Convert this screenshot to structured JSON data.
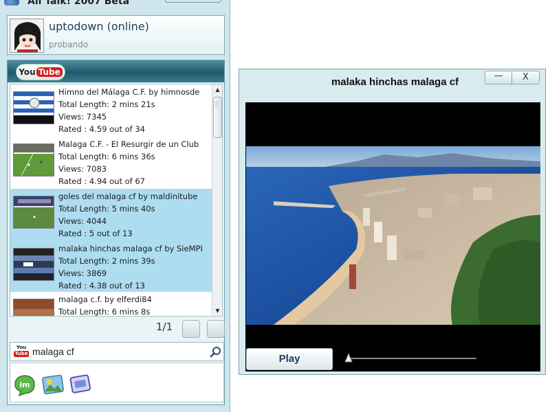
{
  "app": {
    "title": "All Talk! 2007 Beta"
  },
  "profile": {
    "name": "uptodown (online)",
    "status": "probando"
  },
  "youtube": {
    "logo_you": "You",
    "logo_tube": "Tube",
    "results": [
      {
        "title": "Himno del Málaga C.F. by himnosde",
        "length": "Total Length: 2 mins 21s",
        "views": "Views: 7345",
        "rated": "Rated : 4.59 out of 34",
        "selected": false,
        "thumb": "flag-stripes"
      },
      {
        "title": "Malaga C.F. - El Resurgir de un Club",
        "length": "Total Length: 6 mins 36s",
        "views": "Views: 7083",
        "rated": "Rated : 4.94 out of 67",
        "selected": false,
        "thumb": "football-pitch"
      },
      {
        "title": "goles del malaga cf by maldinitube",
        "length": "Total Length: 5 mins 40s",
        "views": "Views: 4044",
        "rated": "Rated : 5 out of 13",
        "selected": true,
        "thumb": "football-pitch"
      },
      {
        "title": "malaka hinchas malaga cf by SieMPI",
        "length": "Total Length: 2 mins 39s",
        "views": "Views: 3869",
        "rated": "Rated : 4.38 out of 13",
        "selected": true,
        "thumb": "stadium-crowd"
      },
      {
        "title": "malaga c.f. by elferdi84",
        "length": "Total Length: 6 mins 8s",
        "views": "",
        "rated": "",
        "selected": false,
        "thumb": "stadium-crowd"
      }
    ],
    "page_indicator": "1/1",
    "search_icon_you": "You",
    "search_icon_tube": "Tube",
    "search_value": "malaga cf"
  },
  "tray": {
    "icons": [
      "messenger-im-icon",
      "photo-gallery-icon",
      "video-screen-icon"
    ]
  },
  "player": {
    "title": "malaka hinchas malaga cf",
    "minimize_label": "—",
    "close_label": "X",
    "play_label": "Play",
    "progress_fraction": 0.0
  },
  "colors": {
    "window_bg": "#cfe6ec",
    "selected_row": "#aedcf0",
    "header_teal": "#1d5a6d",
    "youtube_red": "#d42020"
  }
}
